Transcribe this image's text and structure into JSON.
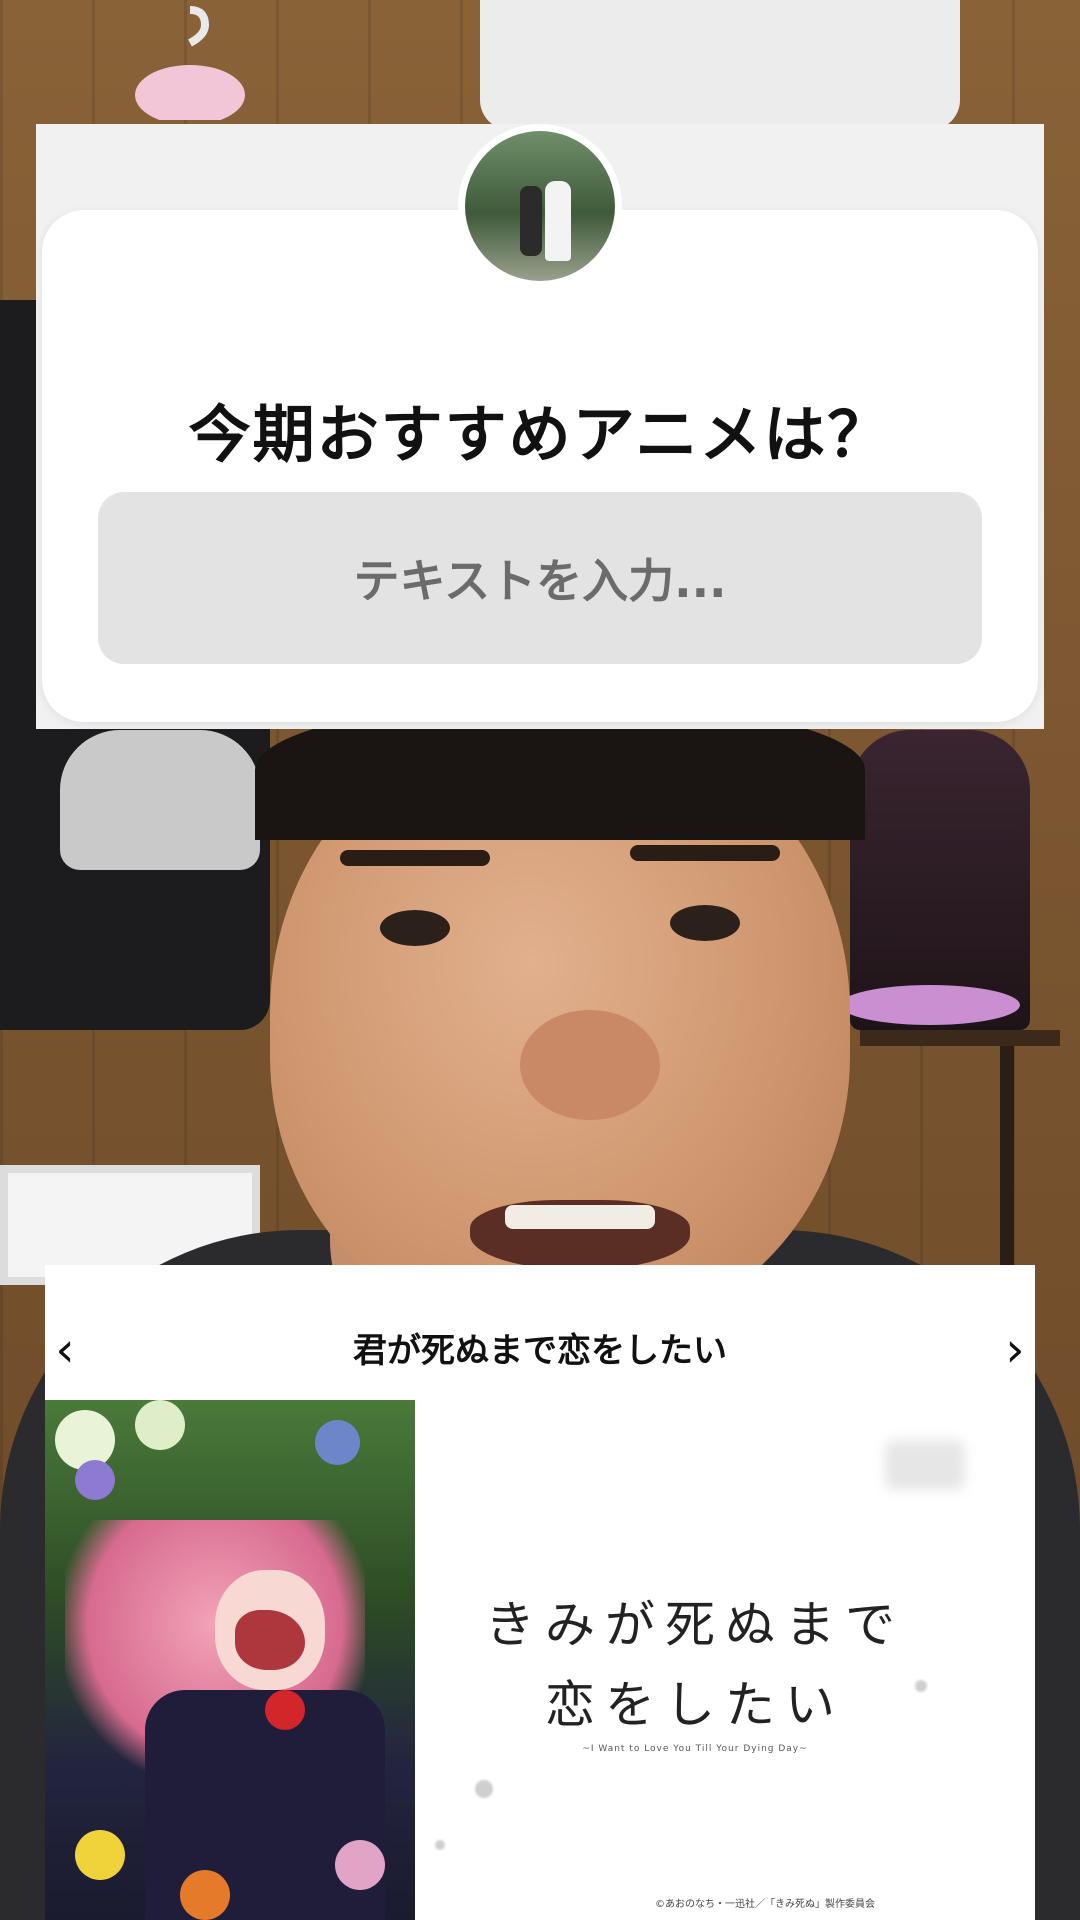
{
  "question_sticker": {
    "question": "今期おすすめアニメは？",
    "input_placeholder": "テキストを入力..."
  },
  "anime_card": {
    "title": "君が死ぬまで恋をしたい",
    "prev_glyph": "‹",
    "next_glyph": "›",
    "logo_line1": "きみが死ぬまで",
    "logo_line2": "恋をしたい",
    "logo_subtitle": "~I Want to Love You Till Your Dying Day~",
    "copyright": "©あおのなち・一迅社／「きみ死ぬ」製作委員会"
  },
  "colors": {
    "sticker_bg": "#ffffff",
    "input_bg": "#e3e3e3",
    "text_dark": "#111111",
    "placeholder": "#6b6b6b"
  }
}
